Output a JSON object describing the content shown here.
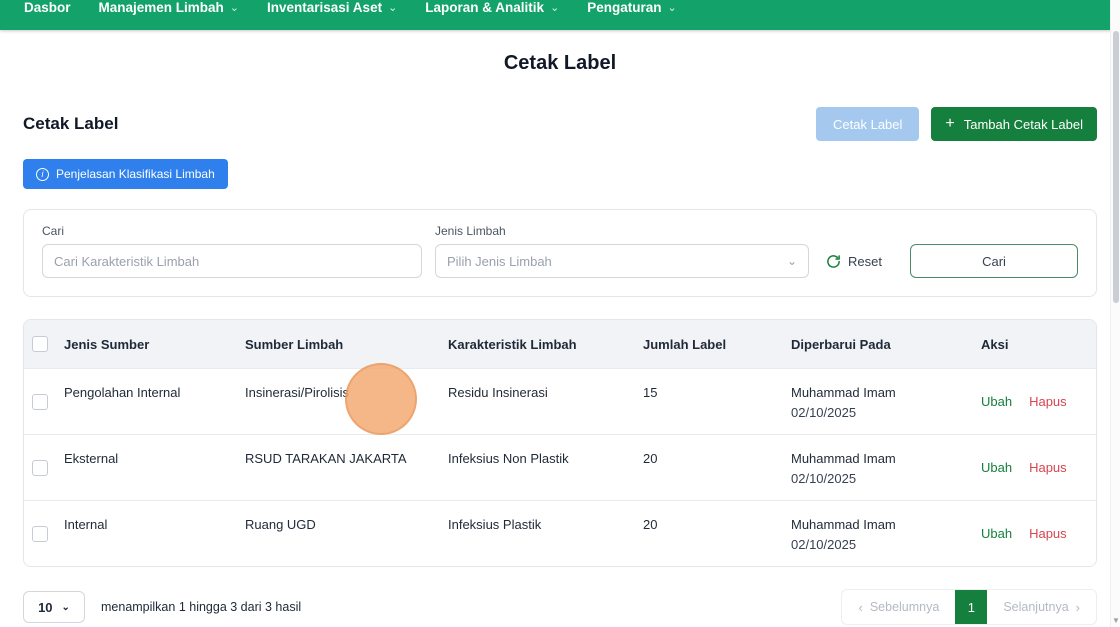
{
  "nav": {
    "items": [
      {
        "label": "Dasbor",
        "has_dropdown": false
      },
      {
        "label": "Manajemen Limbah",
        "has_dropdown": true
      },
      {
        "label": "Inventarisasi Aset",
        "has_dropdown": true
      },
      {
        "label": "Laporan & Analitik",
        "has_dropdown": true
      },
      {
        "label": "Pengaturan",
        "has_dropdown": true
      }
    ]
  },
  "page": {
    "heading": "Cetak Label",
    "section_title": "Cetak Label"
  },
  "toolbar": {
    "cetak_label_button": "Cetak Label",
    "tambah_button": "Tambah Cetak Label",
    "penjelasan_button": "Penjelasan Klasifikasi Limbah"
  },
  "filter": {
    "cari_label": "Cari",
    "cari_placeholder": "Cari Karakteristik Limbah",
    "jenis_label": "Jenis Limbah",
    "jenis_placeholder": "Pilih Jenis Limbah",
    "reset_label": "Reset",
    "cari_button": "Cari"
  },
  "table": {
    "headers": {
      "jenis_sumber": "Jenis Sumber",
      "sumber_limbah": "Sumber Limbah",
      "karakteristik": "Karakteristik Limbah",
      "jumlah": "Jumlah Label",
      "diperbarui": "Diperbarui Pada",
      "aksi": "Aksi"
    },
    "actions": {
      "edit": "Ubah",
      "delete": "Hapus"
    },
    "rows": [
      {
        "jenis_sumber": "Pengolahan Internal",
        "sumber_limbah": "Insinerasi/Pirolisis",
        "karakteristik": "Residu Insinerasi",
        "jumlah": "15",
        "updated_by": "Muhammad Imam",
        "updated_date": "02/10/2025"
      },
      {
        "jenis_sumber": "Eksternal",
        "sumber_limbah": "RSUD TARAKAN JAKARTA",
        "karakteristik": "Infeksius Non Plastik",
        "jumlah": "20",
        "updated_by": "Muhammad Imam",
        "updated_date": "02/10/2025"
      },
      {
        "jenis_sumber": "Internal",
        "sumber_limbah": "Ruang UGD",
        "karakteristik": "Infeksius Plastik",
        "jumlah": "20",
        "updated_by": "Muhammad Imam",
        "updated_date": "02/10/2025"
      }
    ]
  },
  "footer": {
    "page_size": "10",
    "summary": "menampilkan 1 hingga 3 dari 3 hasil",
    "prev_label": "Sebelumnya",
    "current_page": "1",
    "next_label": "Selanjutnya"
  },
  "icons": {
    "chevron_down": "⌄",
    "plus": "+",
    "info": "i",
    "prev_chevron": "‹",
    "next_chevron": "›",
    "scroll_down": "▼"
  },
  "colors": {
    "nav_green": "#13A269",
    "primary_green": "#15803D",
    "info_blue": "#2F80ED",
    "disabled_blue": "#A5C9EE",
    "danger_red": "#D64550"
  }
}
